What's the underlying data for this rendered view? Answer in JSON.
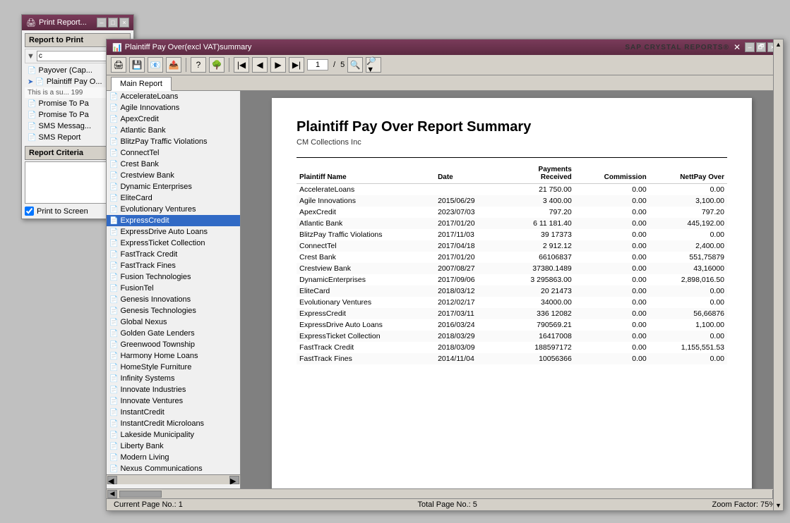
{
  "outer_window": {
    "title": "Print Report...",
    "icon": "🖨",
    "controls": [
      "-",
      "□",
      "×"
    ],
    "section_report": "Report to Print",
    "filter_value": "c",
    "list_items": [
      {
        "label": "Payover (Cap...",
        "selected": false,
        "arrow": false
      },
      {
        "label": "Plaintiff Pay O...",
        "selected": false,
        "arrow": true
      },
      {
        "label": "",
        "selected": false,
        "arrow": false,
        "note": "This is a su... 199"
      },
      {
        "label": "Promise To Pa",
        "selected": false,
        "arrow": false
      },
      {
        "label": "Promise To Pa",
        "selected": false,
        "arrow": false
      },
      {
        "label": "SMS Messag...",
        "selected": false,
        "arrow": false
      },
      {
        "label": "SMS Report",
        "selected": false,
        "arrow": false
      }
    ],
    "section_criteria": "Report Criteria",
    "print_to_screen": true,
    "print_to_screen_label": "Print to Screen"
  },
  "main_window": {
    "title": "Plaintiff Pay Over(excl VAT)summary",
    "icon": "📊",
    "controls": [
      "-",
      "□",
      "×"
    ],
    "toolbar": {
      "page_current": "1",
      "page_total": "5"
    },
    "tab_label": "Main Report",
    "sap_label": "SAP CRYSTAL REPORTS®"
  },
  "report": {
    "title": "Plaintiff Pay Over Report Summary",
    "company": "CM Collections Inc",
    "columns": [
      {
        "key": "plaintiff_name",
        "label": "Plaintiff Name",
        "align": "left"
      },
      {
        "key": "date",
        "label": "Date",
        "align": "left"
      },
      {
        "key": "payments_received",
        "label": "Payments Received",
        "align": "right"
      },
      {
        "key": "commission",
        "label": "Commission",
        "align": "right"
      },
      {
        "key": "nett_pay_over",
        "label": "NettPay Over",
        "align": "right"
      }
    ],
    "rows": [
      {
        "plaintiff_name": "AccelerateLoans",
        "date": "",
        "payments_received": "21 750.00",
        "commission": "0.00",
        "nett_pay_over": "0.00"
      },
      {
        "plaintiff_name": "Agile Innovations",
        "date": "2015/06/29",
        "payments_received": "3 400.00",
        "commission": "0.00",
        "nett_pay_over": "3,100.00"
      },
      {
        "plaintiff_name": "ApexCredit",
        "date": "2023/07/03",
        "payments_received": "797.20",
        "commission": "0.00",
        "nett_pay_over": "797.20"
      },
      {
        "plaintiff_name": "Atlantic Bank",
        "date": "2017/01/20",
        "payments_received": "6 11 181.40",
        "commission": "0.00",
        "nett_pay_over": "445,192.00"
      },
      {
        "plaintiff_name": "BlitzPay Traffic Violations",
        "date": "2017/11/03",
        "payments_received": "39 17373",
        "commission": "0.00",
        "nett_pay_over": "0.00"
      },
      {
        "plaintiff_name": "ConnectTel",
        "date": "2017/04/18",
        "payments_received": "2 912.12",
        "commission": "0.00",
        "nett_pay_over": "2,400.00"
      },
      {
        "plaintiff_name": "Crest Bank",
        "date": "2017/01/20",
        "payments_received": "66106837",
        "commission": "0.00",
        "nett_pay_over": "551,75879"
      },
      {
        "plaintiff_name": "Crestview Bank",
        "date": "2007/08/27",
        "payments_received": "37380.1489",
        "commission": "0.00",
        "nett_pay_over": "43,16000"
      },
      {
        "plaintiff_name": "DynamicEnterprises",
        "date": "2017/09/06",
        "payments_received": "3 295863.00",
        "commission": "0.00",
        "nett_pay_over": "2,898,016.50"
      },
      {
        "plaintiff_name": "EliteCard",
        "date": "2018/03/12",
        "payments_received": "20 21473",
        "commission": "0.00",
        "nett_pay_over": "0.00"
      },
      {
        "plaintiff_name": "Evolutionary Ventures",
        "date": "2012/02/17",
        "payments_received": "34000.00",
        "commission": "0.00",
        "nett_pay_over": "0.00"
      },
      {
        "plaintiff_name": "ExpressCredit",
        "date": "2017/03/11",
        "payments_received": "336 12082",
        "commission": "0.00",
        "nett_pay_over": "56,66876"
      },
      {
        "plaintiff_name": "ExpressDrive Auto Loans",
        "date": "2016/03/24",
        "payments_received": "790569.21",
        "commission": "0.00",
        "nett_pay_over": "1,100.00"
      },
      {
        "plaintiff_name": "ExpressTicket Collection",
        "date": "2018/03/29",
        "payments_received": "16417008",
        "commission": "0.00",
        "nett_pay_over": "0.00"
      },
      {
        "plaintiff_name": "FastTrack Credit",
        "date": "2018/03/09",
        "payments_received": "188597172",
        "commission": "0.00",
        "nett_pay_over": "1,155,551.53"
      },
      {
        "plaintiff_name": "FastTrack Fines",
        "date": "2014/11/04",
        "payments_received": "10056366",
        "commission": "0.00",
        "nett_pay_over": "0.00"
      }
    ]
  },
  "left_list": {
    "items": [
      "AccelerateLoans",
      "Agile Innovations",
      "ApexCredit",
      "Atlantic Bank",
      "BlitzPay Traffic Violations",
      "ConnectTel",
      "Crest Bank",
      "Crestview Bank",
      "Dynamic Enterprises",
      "EliteCard",
      "Evolutionary Ventures",
      "ExpressCredit",
      "ExpressDrive Auto Loans",
      "ExpressTicket Collection",
      "FastTrack Credit",
      "FastTrack Fines",
      "Fusion Technologies",
      "FusionTel",
      "Genesis Innovations",
      "Genesis Technologies",
      "Global Nexus",
      "Golden Gate Lenders",
      "Greenwood Township",
      "Harmony Home Loans",
      "HomeStyle Furniture",
      "Infinity Systems",
      "Innovate Industries",
      "Innovate Ventures",
      "InstantCredit",
      "InstantCredit Microloans",
      "Lakeside Municipality",
      "Liberty Bank",
      "Modern Living",
      "Nexus Communications"
    ],
    "selected": "ExpressCredit"
  },
  "statusbar": {
    "current_page": "Current Page No.: 1",
    "total_pages": "Total Page No.: 5",
    "zoom": "Zoom Factor: 75%"
  }
}
